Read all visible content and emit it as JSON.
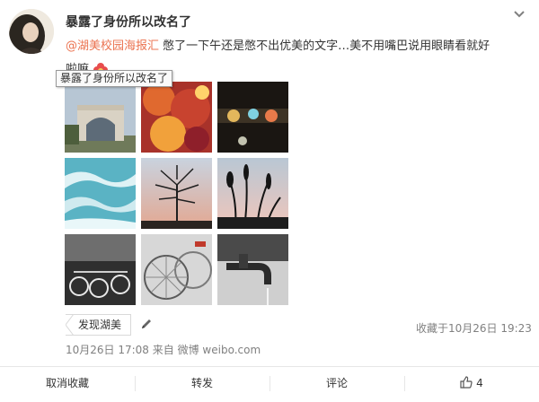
{
  "post": {
    "username": "暴露了身份所以改名了",
    "mention": "@湖美校园海报汇",
    "text_line1": " 憋了一下午还是憋不出优美的文字…美不用嘴巴说用眼睛看就好",
    "text_line2": "啦嘛",
    "tooltip": "暴露了身份所以改名了"
  },
  "images": [
    {
      "icon": "campus-gate-photo"
    },
    {
      "icon": "red-leaves-photo"
    },
    {
      "icon": "window-lights-photo"
    },
    {
      "icon": "sea-waves-photo"
    },
    {
      "icon": "tree-silhouette-photo"
    },
    {
      "icon": "reeds-silhouette-photo"
    },
    {
      "icon": "bicycles-bw-photo"
    },
    {
      "icon": "bicycle-wheels-photo"
    },
    {
      "icon": "faucet-bw-photo"
    }
  ],
  "topic": {
    "label": "发现湖美"
  },
  "collected": "收藏于10月26日 19:23",
  "meta": {
    "time": "10月26日 17:08",
    "source_prefix": "来自",
    "source": "微博 weibo.com"
  },
  "actions": {
    "unfavorite": "取消收藏",
    "repost": "转发",
    "comment": "评论",
    "like_count": "4"
  },
  "colors": {
    "mention": "#eb7350",
    "muted": "#808080",
    "border": "#e6e6e6"
  }
}
